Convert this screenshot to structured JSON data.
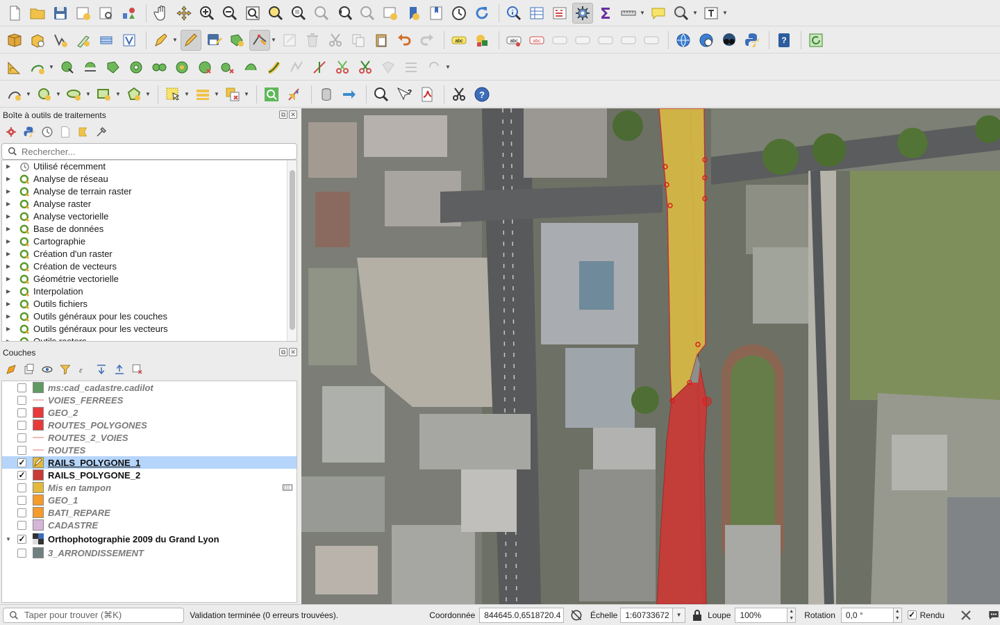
{
  "processing": {
    "title": "Boîte à outils de traitements",
    "search_placeholder": "Rechercher...",
    "items": [
      {
        "label": "Utilisé récemment",
        "icon": "clock-icon"
      },
      {
        "label": "Analyse de réseau",
        "icon": "qgis-icon"
      },
      {
        "label": "Analyse de terrain raster",
        "icon": "qgis-icon"
      },
      {
        "label": "Analyse raster",
        "icon": "qgis-icon"
      },
      {
        "label": "Analyse vectorielle",
        "icon": "qgis-icon"
      },
      {
        "label": "Base de données",
        "icon": "qgis-icon"
      },
      {
        "label": "Cartographie",
        "icon": "qgis-icon"
      },
      {
        "label": "Création d'un raster",
        "icon": "qgis-icon"
      },
      {
        "label": "Création de vecteurs",
        "icon": "qgis-icon"
      },
      {
        "label": "Géométrie vectorielle",
        "icon": "qgis-icon"
      },
      {
        "label": "Interpolation",
        "icon": "qgis-icon"
      },
      {
        "label": "Outils fichiers",
        "icon": "qgis-icon"
      },
      {
        "label": "Outils généraux pour les couches",
        "icon": "qgis-icon"
      },
      {
        "label": "Outils généraux pour les vecteurs",
        "icon": "qgis-icon"
      },
      {
        "label": "Outils rasters",
        "icon": "qgis-icon"
      }
    ]
  },
  "layers": {
    "title": "Couches",
    "items": [
      {
        "name": "ms:cad_cadastre.cadilot",
        "checked": false,
        "symbol": "fill",
        "color": "#5f9a62",
        "visible": false
      },
      {
        "name": "VOIES_FERREES",
        "checked": false,
        "symbol": "line",
        "color": "#e8a29a",
        "visible": false
      },
      {
        "name": "GEO_2",
        "checked": false,
        "symbol": "fill",
        "color": "#e8393a",
        "visible": false
      },
      {
        "name": "ROUTES_POLYGONES",
        "checked": false,
        "symbol": "fill",
        "color": "#e8393a",
        "visible": false
      },
      {
        "name": "ROUTES_2_VOIES",
        "checked": false,
        "symbol": "line",
        "color": "#e8a29a",
        "visible": false
      },
      {
        "name": "ROUTES",
        "checked": false,
        "symbol": "line",
        "color": "#e8a29a",
        "visible": false
      },
      {
        "name": "RAILS_POLYGONE_1",
        "checked": true,
        "symbol": "edit",
        "color": "#e2b93b",
        "visible": true,
        "selected": true,
        "underline": true
      },
      {
        "name": "RAILS_POLYGONE_2",
        "checked": true,
        "symbol": "fill",
        "color": "#c93a36",
        "visible": true
      },
      {
        "name": "Mis en tampon",
        "checked": false,
        "symbol": "fill",
        "color": "#e2b93b",
        "visible": false,
        "memory": true
      },
      {
        "name": "GEO_1",
        "checked": false,
        "symbol": "fill",
        "color": "#f59b2a",
        "visible": false
      },
      {
        "name": "BATI_REPARE",
        "checked": false,
        "symbol": "fill",
        "color": "#f59b2a",
        "visible": false
      },
      {
        "name": "CADASTRE",
        "checked": false,
        "symbol": "fill",
        "color": "#d6b6d8",
        "visible": false
      },
      {
        "name": "Orthophotographie 2009 du Grand Lyon",
        "checked": true,
        "symbol": "raster",
        "color": "#333333",
        "visible": true,
        "group": true
      },
      {
        "name": "3_ARRONDISSEMENT",
        "checked": false,
        "symbol": "fill",
        "color": "#6f8080",
        "visible": false
      }
    ]
  },
  "status": {
    "locator_placeholder": "Taper pour trouver (⌘K)",
    "message": "Validation terminée (0 erreurs trouvées).",
    "coord_label": "Coordonnée",
    "coord_value": "844645.0,6518720.4",
    "scale_label": "Échelle",
    "scale_value": "1:60733672",
    "magnifier_label": "Loupe",
    "magnifier_value": "100%",
    "rotation_label": "Rotation",
    "rotation_value": "0,0 °",
    "render_label": "Rendu",
    "render_checked": true
  }
}
